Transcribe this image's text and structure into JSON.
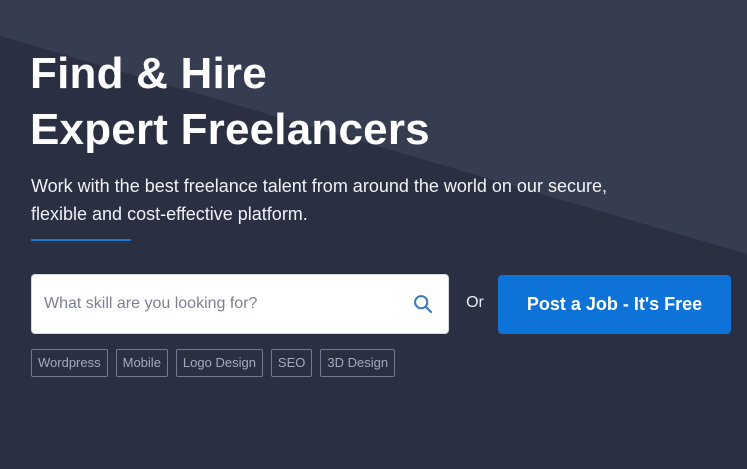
{
  "hero": {
    "headline_line_1": "Find & Hire",
    "headline_line_2": "Expert Freelancers",
    "subtitle_line_1": "Work with the best freelance talent from around the world on our secure,",
    "subtitle_line_2": "flexible and cost-effective platform.",
    "accent_color": "#1a78d0"
  },
  "search": {
    "placeholder": "What skill are you looking for?",
    "value": "",
    "icon": "search-icon",
    "icon_color": "#3d78b7"
  },
  "separator": {
    "label": "Or"
  },
  "cta": {
    "label": "Post a Job - It's Free",
    "color": "#0e73d9"
  },
  "tags": [
    {
      "label": "Wordpress"
    },
    {
      "label": "Mobile"
    },
    {
      "label": "Logo Design"
    },
    {
      "label": "SEO"
    },
    {
      "label": "3D Design"
    }
  ]
}
